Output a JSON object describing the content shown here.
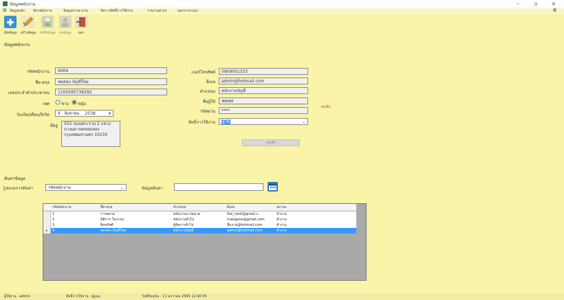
{
  "window": {
    "title": "ข้อมูลพนักงาน"
  },
  "menu": [
    "ข้อมูลหลัก",
    "บัตรพนักงาน",
    "ข้อมูลการลางาน",
    "จัดการสิทธิ์การใช้งาน",
    "รายงานต่างๆ",
    "ออกจากระบบ"
  ],
  "toolbar": {
    "add": "เพิ่มข้อมูล",
    "edit": "แก้ไขข้อมูล",
    "save": "บันทึกข้อมูล",
    "delete": "ลบข้อมูล",
    "exit": "ออก"
  },
  "section_title": "ข้อมูลพนักงาน",
  "form": {
    "emp_id_label": "รหัสพนักงาน",
    "emp_id": "0004",
    "name_label": "ชื่อ-สกุล",
    "name": "ทดสอบ บัญชีใหม่",
    "citizen_label": "เลขประจำตัวประชาชน",
    "citizen": "1100265736292",
    "gender_label": "เพศ",
    "gender_male": "ชาย",
    "gender_female": "หญิง",
    "birth_label": "วันเกิด/เดือน/ปีเกิด",
    "birth_day": "6",
    "birth_month": "สิงหาคม",
    "birth_year": "2538",
    "address_label": "ที่อยู่",
    "address": "552 ถนนพระราม 2 แขวงบางมด เขตจอมทอง กรุงเทพมหานคร 10150",
    "phone_label": "เบอร์โทรศัพท์",
    "phone": "0909051333",
    "email_label": "อีเมล",
    "email": "admin@hotmail.com",
    "position_label": "ตำแหน่ง",
    "position": "พนักงานบัญชี",
    "username_label": "ชื่อผู้ใช้",
    "username": "ฟฟฟฟ",
    "password_label": "รหัสผ่าน",
    "password": "****",
    "role_label": "สิทธิ์การใช้งาน",
    "role": "ผู้ใช้",
    "warning": "ยกเลิก",
    "confirm_button": "ยกเลิก"
  },
  "search": {
    "group_title": "ค้นหาข้อมูล",
    "type_label": "รูปแบบการค้นหา",
    "type_value": "รหัสพนักงาน",
    "keyword_label": "ข้อมูลค้นหา",
    "keyword_value": ""
  },
  "table": {
    "columns": [
      "รหัสพนักงาน",
      "ชื่อ-สกุล",
      "ตำแหน่ง",
      "อีเมล",
      "สถานะ"
    ],
    "rows": [
      [
        "1",
        "การตลาด",
        "พนักงานการตลาด",
        "the_rank@gmail.c...",
        "ทำงาน"
      ],
      [
        "2",
        "นิติการ ในระบบ",
        "พนักงานทั่วไป",
        "mangane@gmail.com",
        "ทำงาน"
      ],
      [
        "3",
        "สินทรัพย์",
        "ผู้จัดการทั่วไป",
        "ทีมงาน@hotmail.com",
        "ทำงาน"
      ],
      [
        "4",
        "ทดสอบ บัญชีใหม่",
        "พนักงานบัญชี",
        "admin@hotmail.com",
        "ทำงาน"
      ]
    ],
    "selected_row": 3
  },
  "statusbar": {
    "user_label": "ผู้ใช้งาน : admin",
    "role_label": "สิทธิ์การใช้งาน : ผู้ดูแล",
    "datetime_label": "วันที่ปัจจุบัน : 13 มกราคม 2565 12:40:05"
  },
  "colors": {
    "background": "#f9f4a7",
    "selection": "#3399ff",
    "warning": "#d91a1a"
  }
}
